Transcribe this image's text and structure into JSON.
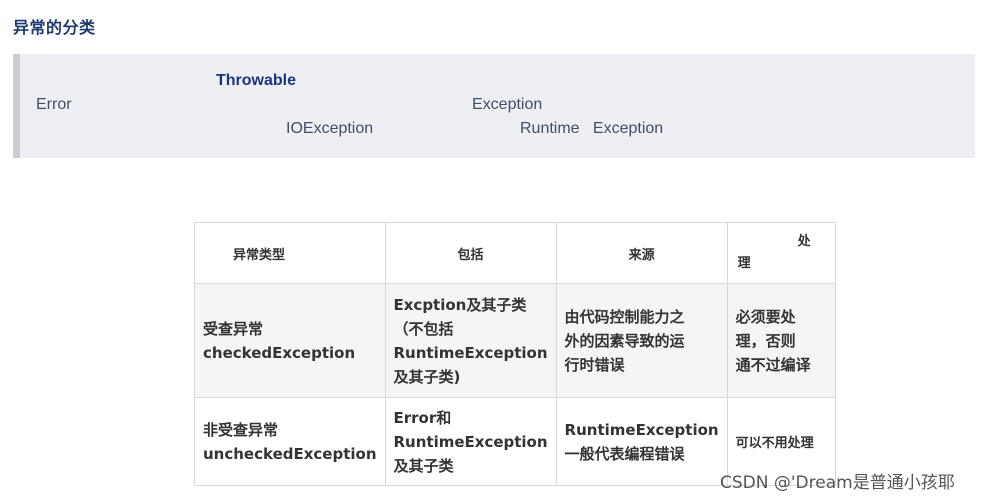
{
  "heading": "异常的分类",
  "hierarchy": {
    "root": "Throwable",
    "error": "Error",
    "exception": "Exception",
    "io_exception": "IOException",
    "runtime_exception": "Runtime   Exception"
  },
  "table": {
    "headers": {
      "type": "异常类型",
      "includes": "包括",
      "source": "来源",
      "handling_part1": "处",
      "handling_part2": "理"
    },
    "rows": [
      {
        "type_line1": "受查异常",
        "type_line2": "checkedException",
        "includes_line1": "Excption及其子类",
        "includes_line2": "（不包括",
        "includes_line3": "RuntimeException",
        "includes_line4": "及其子类)",
        "source_line1": "由代码控制能力之",
        "source_line2": "外的因素导致的运",
        "source_line3": "行时错误",
        "handling_line1": "必须要处",
        "handling_line2": "理，否则",
        "handling_line3": "通不过编译"
      },
      {
        "type_line1": "非受查异常",
        "type_line2": "uncheckedException",
        "includes_line1": "Error和",
        "includes_line2": "RuntimeException",
        "includes_line3": "及其子类",
        "source_line1": "RuntimeException",
        "source_line2": "一般代表编程错误",
        "handling": "可以不用处理"
      }
    ]
  },
  "watermark": "CSDN @'Dream是普通小孩耶"
}
